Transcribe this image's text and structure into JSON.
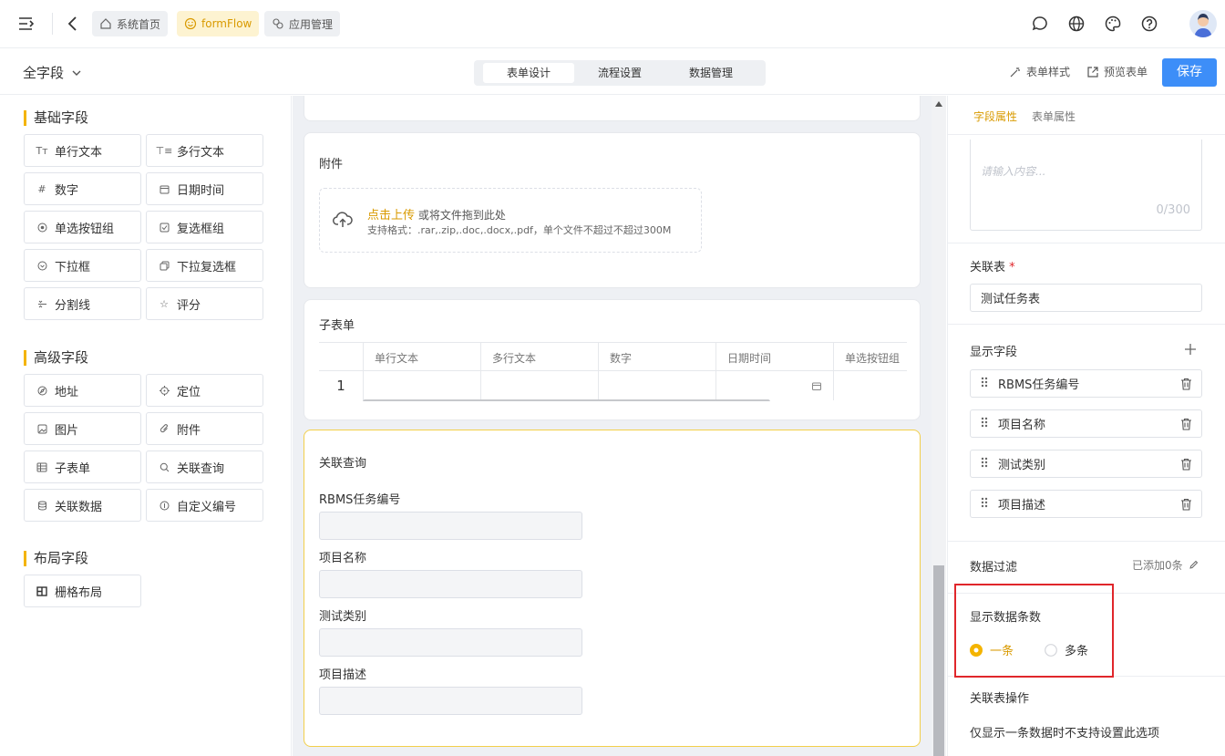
{
  "topbar": {
    "tabs": [
      {
        "label": "系统首页",
        "icon": "home-icon"
      },
      {
        "label": "formFlow",
        "icon": "smile-icon"
      },
      {
        "label": "应用管理",
        "icon": "apps-icon"
      }
    ],
    "right_icons": [
      "message-icon",
      "globe-icon",
      "palette-icon",
      "help-icon",
      "avatar"
    ]
  },
  "toolbar": {
    "field_selector": "全字段",
    "segments": [
      "表单设计",
      "流程设置",
      "数据管理"
    ],
    "active_segment": "表单设计",
    "form_style": "表单样式",
    "preview": "预览表单",
    "save": "保存"
  },
  "left": {
    "groups": [
      {
        "title": "基础字段"
      },
      {
        "title": "高级字段"
      },
      {
        "title": "布局字段"
      }
    ],
    "basic": [
      "单行文本",
      "多行文本",
      "数字",
      "日期时间",
      "单选按钮组",
      "复选框组",
      "下拉框",
      "下拉复选框",
      "分割线",
      "评分"
    ],
    "advanced": [
      "地址",
      "定位",
      "图片",
      "附件",
      "子表单",
      "关联查询",
      "关联数据",
      "自定义编号"
    ],
    "layout": [
      "栅格布局"
    ]
  },
  "canvas": {
    "attachment": {
      "title": "附件",
      "upload_link": "点击上传",
      "upload_text": "或将文件拖到此处",
      "hint": "支持格式：.rar,.zip,.doc,.docx,.pdf，单个文件不超过不超过300M"
    },
    "subform": {
      "title": "子表单",
      "columns": [
        "单行文本",
        "多行文本",
        "数字",
        "日期时间",
        "单选按钮组"
      ],
      "row_number": "1"
    },
    "lookup": {
      "title": "关联查询",
      "fields": [
        "RBMS任务编号",
        "项目名称",
        "测试类别",
        "项目描述"
      ]
    }
  },
  "right": {
    "tabs": [
      "字段属性",
      "表单属性"
    ],
    "active_tab": "字段属性",
    "textarea_placeholder": "请输入内容...",
    "textarea_count": "0/300",
    "linked_table_label": "关联表",
    "required_mark": "*",
    "linked_table_value": "测试任务表",
    "display_fields_label": "显示字段",
    "display_fields": [
      "RBMS任务编号",
      "项目名称",
      "测试类别",
      "项目描述"
    ],
    "data_filter_label": "数据过滤",
    "data_filter_value": "已添加0条",
    "record_count_label": "显示数据条数",
    "record_options": [
      "一条",
      "多条"
    ],
    "record_selected": "一条",
    "linked_ops_label": "关联表操作",
    "linked_ops_note": "仅显示一条数据时不支持设置此选项"
  },
  "colors": {
    "accent": "#f4b400",
    "primary": "#3d8ef8",
    "highlight": "#e0262b"
  }
}
